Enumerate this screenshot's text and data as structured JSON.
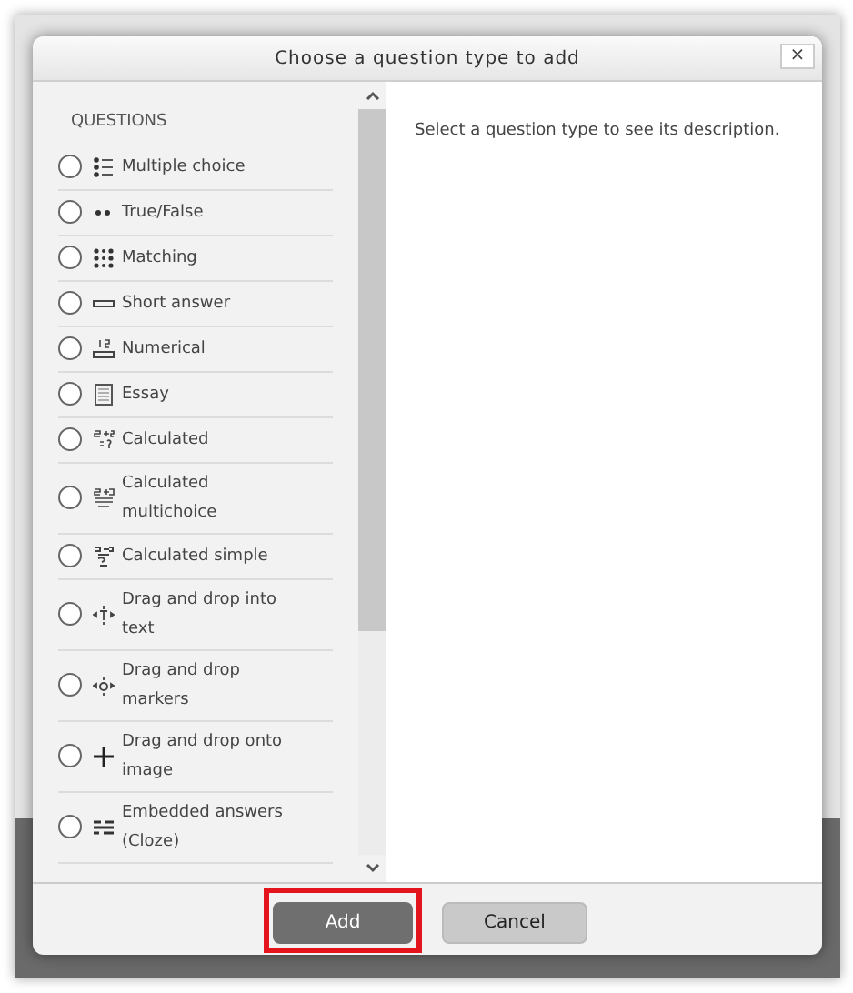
{
  "dialog": {
    "title": "Choose a question type to add",
    "close": "×"
  },
  "list": {
    "heading": "QUESTIONS",
    "items": [
      {
        "label": "Multiple choice",
        "selected": false
      },
      {
        "label": "True/False",
        "selected": false
      },
      {
        "label": "Matching",
        "selected": false
      },
      {
        "label": "Short answer",
        "selected": false
      },
      {
        "label": "Numerical",
        "selected": false
      },
      {
        "label": "Essay",
        "selected": false
      },
      {
        "label": "Calculated",
        "selected": false
      },
      {
        "label": "Calculated multichoice",
        "selected": false
      },
      {
        "label": "Calculated simple",
        "selected": false
      },
      {
        "label": "Drag and drop into text",
        "selected": false
      },
      {
        "label": "Drag and drop markers",
        "selected": false
      },
      {
        "label": "Drag and drop onto image",
        "selected": false
      },
      {
        "label": "Embedded answers (Cloze)",
        "selected": false
      }
    ]
  },
  "description": "Select a question type to see its description.",
  "buttons": [
    {
      "label": "Add",
      "kind": "primary",
      "highlighted": true
    },
    {
      "label": "Cancel",
      "kind": "secondary",
      "highlighted": false
    }
  ]
}
